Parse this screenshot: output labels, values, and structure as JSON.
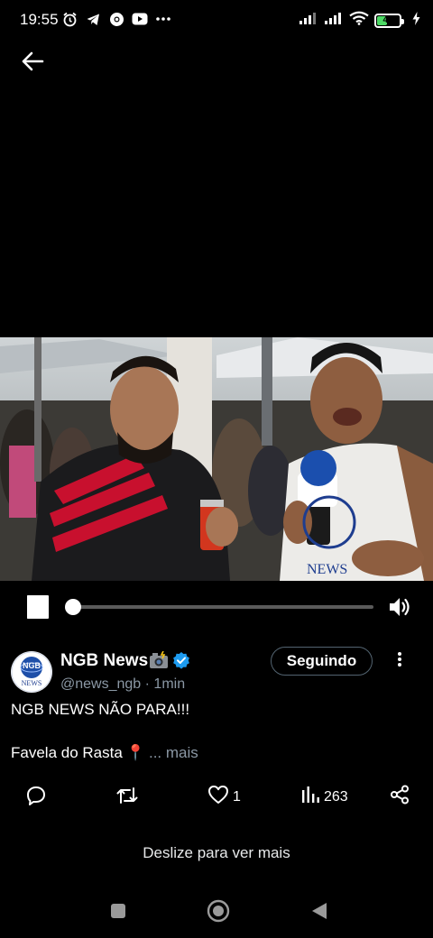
{
  "status_bar": {
    "time": "19:55",
    "left_icons": [
      "alarm-icon",
      "telegram-icon",
      "chrome-icon",
      "youtube-icon",
      "more-dots-icon"
    ],
    "right_icons": [
      "signal-icon",
      "signal-icon",
      "wifi-icon",
      "battery-icon",
      "charging-icon"
    ],
    "battery_level": "43",
    "battery_color": "#4cd964"
  },
  "header": {
    "back_icon": "arrow-left-icon"
  },
  "video": {
    "state": "playing",
    "progress": 0.0,
    "controls": {
      "pause_icon": "pause-icon",
      "volume_icon": "volume-icon"
    }
  },
  "tweet": {
    "author_name": "NGB News",
    "author_badges": [
      "camera-flash-emoji",
      "verified-badge-icon"
    ],
    "handle": "@news_ngb",
    "separator": "·",
    "time_ago": "1min",
    "follow_label": "Seguindo",
    "text_line1": "NGB NEWS NÃO PARA!!!",
    "text_line2": "Favela do Rasta",
    "location_emoji": "📍",
    "more_label": "... mais",
    "avatar_text": "NGB",
    "avatar_subtext": "NEWS"
  },
  "actions": {
    "reply_icon": "reply-icon",
    "retweet_icon": "retweet-icon",
    "like_icon": "heart-icon",
    "like_count": "1",
    "views_icon": "bar-chart-icon",
    "views_count": "263",
    "share_icon": "share-icon"
  },
  "swipe_hint": "Deslize para ver mais",
  "nav_bar": {
    "buttons": [
      "recents-icon",
      "home-icon",
      "back-icon"
    ]
  },
  "colors": {
    "background": "#000000",
    "secondary_text": "#8b98a5",
    "verified": "#1d9bf0",
    "follow_border": "#536471"
  }
}
